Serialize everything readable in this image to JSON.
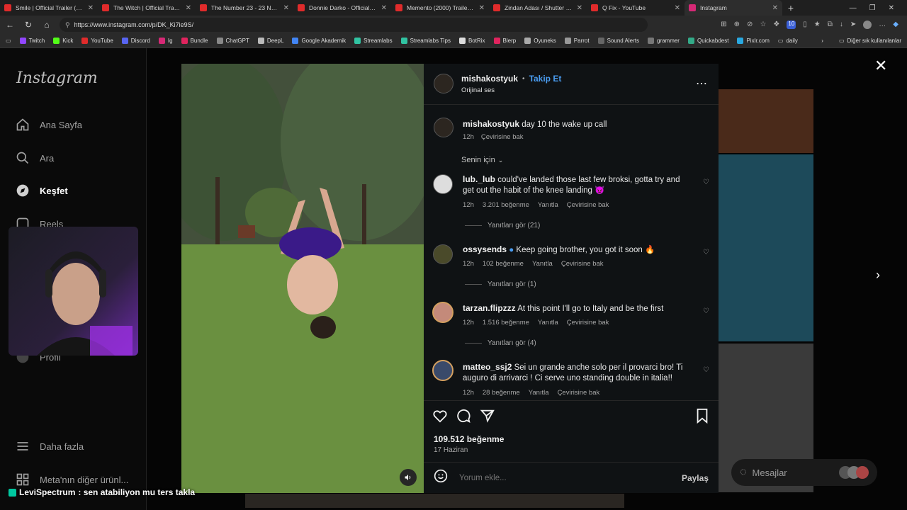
{
  "browser": {
    "tabs": [
      {
        "title": "Smile | Official Trailer (2022",
        "color": "#e02b2b"
      },
      {
        "title": "The Witch | Official Trailer H",
        "color": "#e02b2b"
      },
      {
        "title": "The Number 23 - 23 Numa",
        "color": "#e02b2b"
      },
      {
        "title": "Donnie Darko - Official Trail",
        "color": "#e02b2b"
      },
      {
        "title": "Memento (2000) Trailer #1",
        "color": "#e02b2b"
      },
      {
        "title": "Zindan Adası / Shutter Islan",
        "color": "#e02b2b"
      },
      {
        "title": "Q Fix - YouTube",
        "color": "#e02b2b"
      },
      {
        "title": "Instagram",
        "color": "#d62976"
      }
    ],
    "url": "https://www.instagram.com/p/DK_Ki7ie9S/",
    "bookmarks": [
      "Twitch",
      "Kick",
      "YouTube",
      "Discord",
      "Ig",
      "Bundle",
      "ChatGPT",
      "DeepL",
      "Google Akademik",
      "Streamlabs",
      "Streamlabs Tips",
      "BotRix",
      "Blerp",
      "Oyuneks",
      "Parrot",
      "Sound Alerts",
      "grammer",
      "Quickabdest",
      "Pixlr.com",
      "daily"
    ],
    "bookmarks_other": "Diğer sık kullanılanlar",
    "badge_count": "10"
  },
  "sidebar": {
    "logo": "Instagram",
    "items": [
      {
        "label": "Ana Sayfa"
      },
      {
        "label": "Ara"
      },
      {
        "label": "Keşfet"
      },
      {
        "label": "Reels"
      },
      {
        "label": "Profil"
      },
      {
        "label": "Daha fazla"
      },
      {
        "label": "Meta'nın diğer ürünl..."
      }
    ]
  },
  "post": {
    "author": "mishakostyuk",
    "follow": "Takip Et",
    "audio": "Orijinal ses",
    "caption_user": "mishakostyuk",
    "caption": "day 10 the wake up call",
    "caption_time": "12h",
    "caption_translate": "Çevirisine bak",
    "for_you": "Senin için",
    "comments": [
      {
        "user": "lub._lub",
        "text": "could've landed those last few broksi, gotta try and get out the habit of the knee landing 😈",
        "time": "12h",
        "likes": "3.201 beğenme",
        "reply": "Yanıtla",
        "translate": "Çevirisine bak",
        "replies": "Yanıtları gör (21)"
      },
      {
        "user": "ossysends",
        "text": "Keep going brother, you got it soon 🔥",
        "time": "12h",
        "likes": "102 beğenme",
        "reply": "Yanıtla",
        "translate": "Çevirisine bak",
        "replies": "Yanıtları gör (1)"
      },
      {
        "user": "tarzan.flipzzz",
        "text": "At this point I'll go to Italy and be the first",
        "time": "12h",
        "likes": "1.516 beğenme",
        "reply": "Yanıtla",
        "translate": "Çevirisine bak",
        "replies": "Yanıtları gör (4)"
      },
      {
        "user": "matteo_ssj2",
        "text": "Sei un grande anche solo per il provarci bro! Ti auguro di arrivarci ! Ci serve uno standing double in italia!!",
        "time": "12h",
        "likes": "28 beğenme",
        "reply": "Yanıtla",
        "translate": "Çevirisine bak"
      }
    ],
    "like_count": "109.512 beğenme",
    "date": "17 Haziran",
    "comment_placeholder": "Yorum ekle...",
    "share": "Paylaş"
  },
  "messages": "Mesajlar",
  "chat": {
    "name": "LeviSpectrum",
    "message": ": sen atabiliyon mu ters takla"
  }
}
